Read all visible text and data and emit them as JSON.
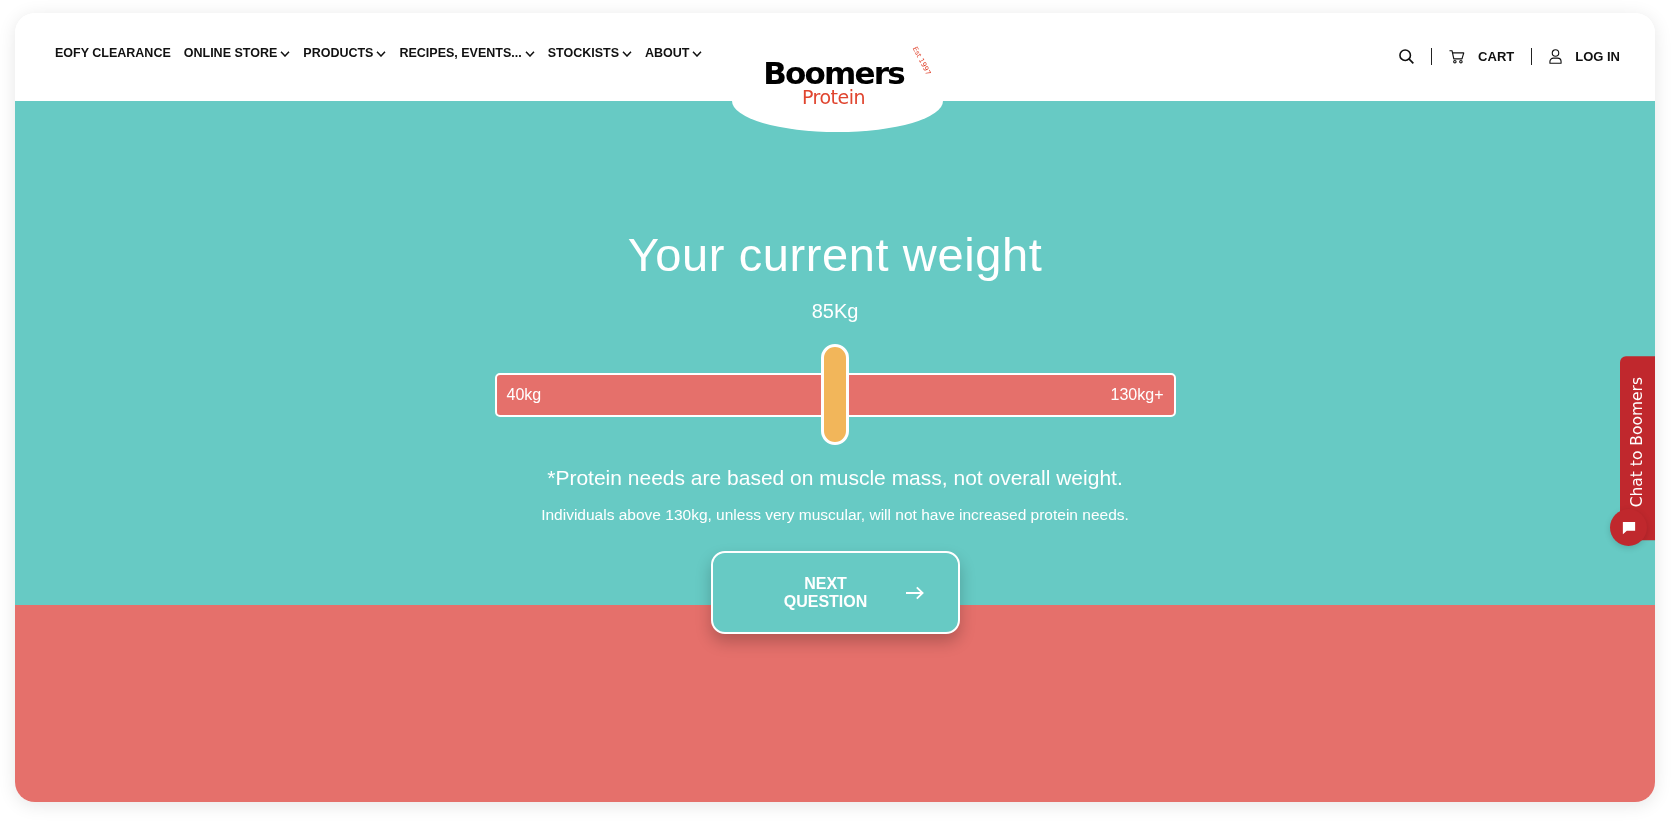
{
  "header": {
    "nav": [
      {
        "label": "EOFY CLEARANCE",
        "kind": "link"
      },
      {
        "label": "ONLINE STORE",
        "kind": "menu"
      },
      {
        "label": "PRODUCTS",
        "kind": "menu"
      },
      {
        "label": "RECIPES, EVENTS...",
        "kind": "menu"
      },
      {
        "label": "STOCKISTS",
        "kind": "menu"
      },
      {
        "label": "ABOUT",
        "kind": "menu"
      }
    ],
    "logo": {
      "wordmark": "Boomers",
      "tagline": "Protein",
      "est": "Est 1997"
    },
    "actions": [
      {
        "kind": "search"
      },
      {
        "kind": "cart",
        "label": "CART"
      },
      {
        "kind": "account",
        "label": "LOG IN"
      }
    ]
  },
  "question": {
    "title": "Your current weight",
    "reading": "85Kg",
    "slider": {
      "min_label": "40kg",
      "max_label": "130kg+",
      "level": 0.5
    },
    "note": "*Protein needs are based on muscle mass, not overall weight.",
    "subnote": "Individuals above 130kg, unless very muscular, will not have increased protein needs.",
    "next_button": {
      "label": "NEXT QUESTION"
    }
  },
  "chat": {
    "label": "Chat to Boomers"
  }
}
